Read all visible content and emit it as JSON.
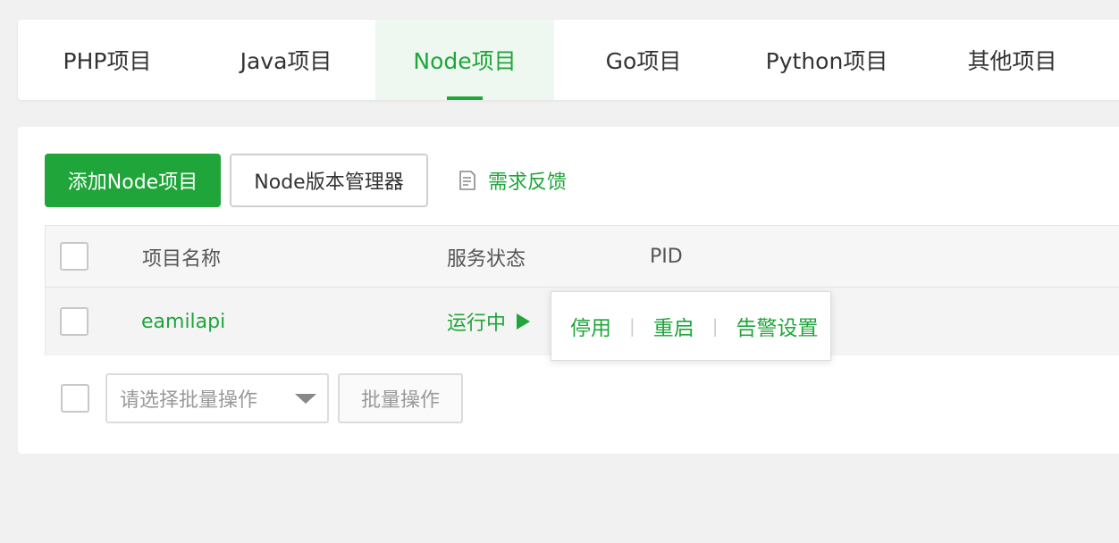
{
  "tabs": [
    {
      "label": "PHP项目"
    },
    {
      "label": "Java项目"
    },
    {
      "label": "Node项目"
    },
    {
      "label": "Go项目"
    },
    {
      "label": "Python项目"
    },
    {
      "label": "其他项目"
    }
  ],
  "active_tab": "Node项目",
  "toolbar": {
    "add_label": "添加Node项目",
    "version_manager_label": "Node版本管理器",
    "feedback_label": "需求反馈"
  },
  "table": {
    "headers": {
      "name": "项目名称",
      "status": "服务状态",
      "pid": "PID"
    },
    "rows": [
      {
        "name": "eamilapi",
        "status": "运行中"
      }
    ]
  },
  "popover": {
    "stop": "停用",
    "restart": "重启",
    "alert": "告警设置"
  },
  "batch": {
    "select_placeholder": "请选择批量操作",
    "button_label": "批量操作"
  },
  "colors": {
    "accent": "#20a53a"
  }
}
